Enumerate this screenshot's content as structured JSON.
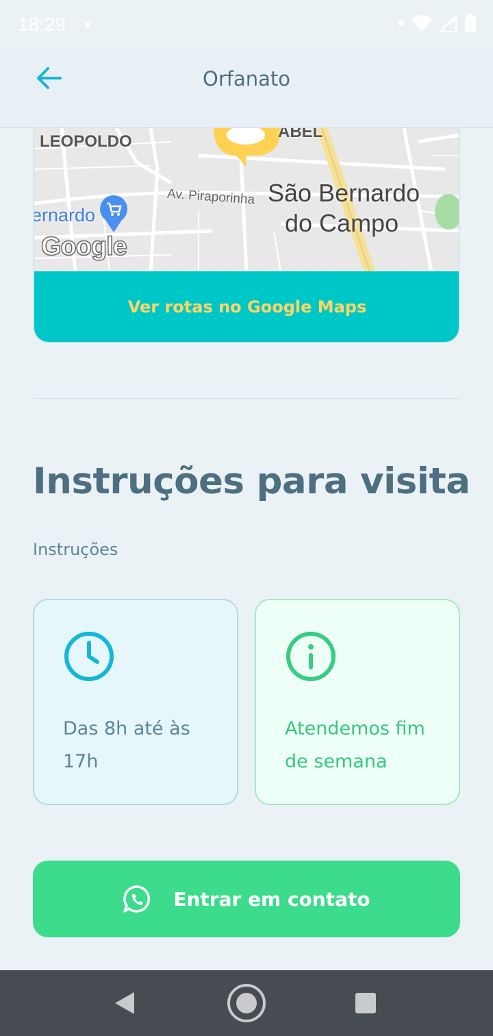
{
  "status_bar": {
    "time": "18:29"
  },
  "header": {
    "title": "Orfanato"
  },
  "map": {
    "labels": {
      "district": "LEOPOLDO",
      "district2": "ABEL",
      "street": "Av. Piraporinha",
      "city_line1": "São Bernardo",
      "city_line2": "do Campo",
      "place_partial": "ernardo",
      "brand": "Google"
    },
    "button_label": "Ver rotas no Google Maps"
  },
  "instructions": {
    "title": "Instruções para visita",
    "label": "Instruções",
    "cards": [
      {
        "text": "Das 8h até às 17h",
        "icon": "clock-icon",
        "color": "#15b6d6"
      },
      {
        "text": "Atendemos fim de semana",
        "icon": "info-icon",
        "color": "#39cc83"
      }
    ]
  },
  "contact_button": {
    "label": "Entrar em contato",
    "icon": "whatsapp-icon"
  },
  "colors": {
    "primary_text": "#4d6f80",
    "map_button": "#00c7c7",
    "map_button_text": "#ffd666",
    "contact_button": "#3cdc8c",
    "background": "#ebf2f5"
  }
}
